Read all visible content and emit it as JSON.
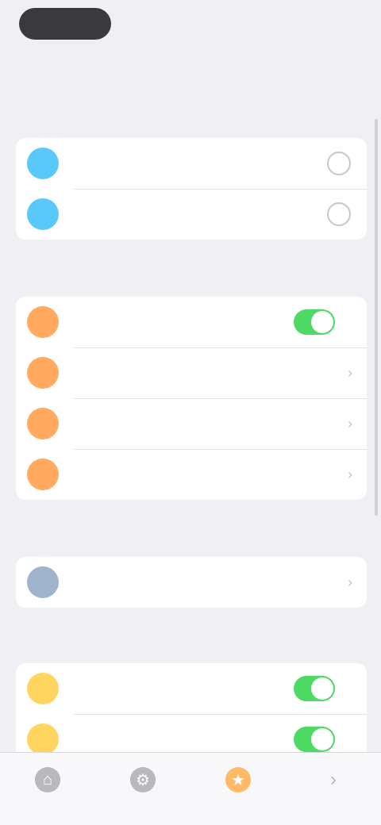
{
  "top": {
    "title": "",
    "action_label": ""
  },
  "sections": [
    {
      "header": "",
      "rows": [
        {
          "label": "",
          "icon": "blue-circle-icon",
          "control": "round-button"
        },
        {
          "label": "",
          "icon": "blue-circle-icon",
          "control": "round-button"
        }
      ]
    },
    {
      "header": "",
      "rows": [
        {
          "label": "",
          "icon": "orange-circle-icon",
          "control": "toggle",
          "toggle_on": true
        },
        {
          "label": "",
          "value": "",
          "icon": "orange-circle-icon",
          "control": "chevron"
        },
        {
          "label": "",
          "value": "",
          "icon": "orange-circle-icon",
          "control": "chevron"
        },
        {
          "label": "",
          "value": "",
          "icon": "orange-circle-icon",
          "control": "chevron"
        }
      ]
    },
    {
      "header": "",
      "rows": [
        {
          "label": "",
          "icon": "grey-circle-icon",
          "control": "chevron"
        }
      ]
    },
    {
      "header": "",
      "rows": [
        {
          "label": "",
          "icon": "yellow-circle-icon",
          "control": "toggle",
          "toggle_on": true
        },
        {
          "label": "",
          "icon": "yellow-circle-icon",
          "control": "toggle",
          "toggle_on": true
        }
      ]
    }
  ],
  "tab_bar": [
    {
      "icon": "home-icon"
    },
    {
      "icon": "settings-icon"
    },
    {
      "icon": "star-icon",
      "active": true
    },
    {
      "icon": "arrow-icon"
    }
  ],
  "colors": {
    "accent_green": "#4cd964",
    "blue": "#5ac8fa",
    "orange": "#ffaa60",
    "yellow": "#ffd560",
    "background": "#efeff4"
  }
}
